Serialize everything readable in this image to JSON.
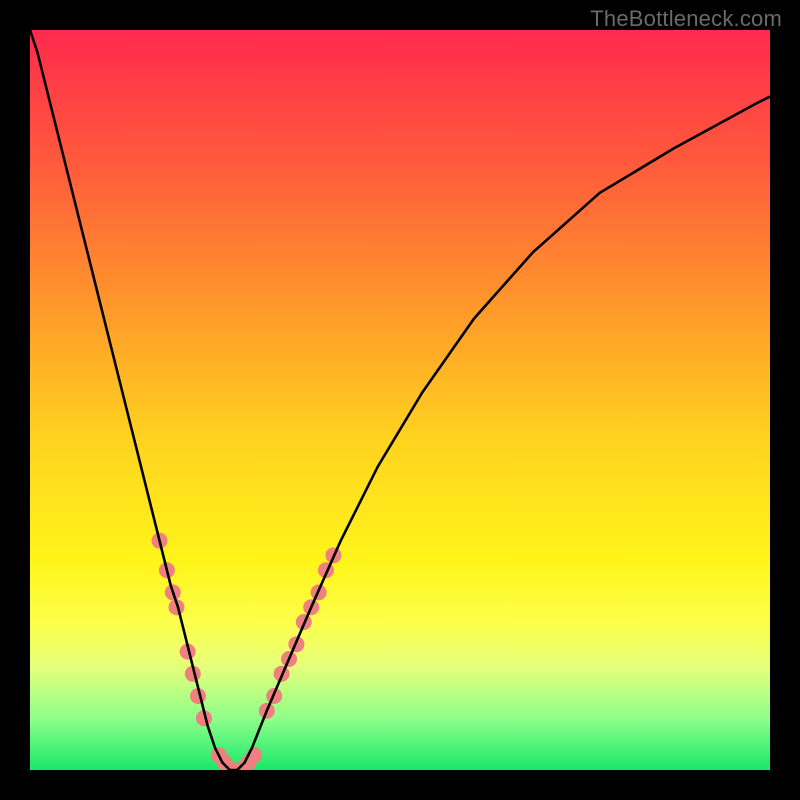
{
  "watermark": "TheBottleneck.com",
  "chart_data": {
    "type": "line",
    "title": "",
    "xlabel": "",
    "ylabel": "",
    "xlim": [
      0,
      100
    ],
    "ylim": [
      0,
      100
    ],
    "legend": false,
    "grid": false,
    "background_gradient_stops": [
      {
        "offset": 0,
        "color": "#ff2a4d"
      },
      {
        "offset": 0.18,
        "color": "#ff5a3c"
      },
      {
        "offset": 0.38,
        "color": "#ff9a2a"
      },
      {
        "offset": 0.55,
        "color": "#ffd21f"
      },
      {
        "offset": 0.72,
        "color": "#fff51a"
      },
      {
        "offset": 0.8,
        "color": "#fcff4a"
      },
      {
        "offset": 0.86,
        "color": "#e6ff7a"
      },
      {
        "offset": 0.93,
        "color": "#8fff8a"
      },
      {
        "offset": 1.0,
        "color": "#19e86a"
      }
    ],
    "series": [
      {
        "name": "curve",
        "color": "#000000",
        "x": [
          0,
          1,
          2,
          3,
          5,
          7,
          9,
          11,
          13,
          15,
          17,
          19,
          20,
          21,
          22,
          23,
          24,
          25,
          26,
          27,
          28,
          29,
          30,
          32,
          35,
          38,
          42,
          47,
          53,
          60,
          68,
          77,
          87,
          98,
          100
        ],
        "y": [
          100,
          97,
          93,
          89,
          81,
          73,
          65,
          57,
          49,
          41,
          33,
          25,
          22,
          18,
          14,
          10,
          6,
          3,
          1,
          0,
          0,
          1,
          3,
          8,
          15,
          22,
          31,
          41,
          51,
          61,
          70,
          78,
          84,
          90,
          91
        ]
      }
    ],
    "marker_series": [
      {
        "name": "left-outer-cluster",
        "color": "#f08080",
        "points": [
          {
            "x": 17.5,
            "y": 31
          },
          {
            "x": 18.5,
            "y": 27
          },
          {
            "x": 19.3,
            "y": 24
          },
          {
            "x": 19.8,
            "y": 22
          }
        ]
      },
      {
        "name": "left-inner-cluster",
        "color": "#f08080",
        "points": [
          {
            "x": 21.3,
            "y": 16
          },
          {
            "x": 22.0,
            "y": 13
          },
          {
            "x": 22.7,
            "y": 10
          },
          {
            "x": 23.5,
            "y": 7
          }
        ]
      },
      {
        "name": "valley-floor",
        "color": "#f08080",
        "points": [
          {
            "x": 25.5,
            "y": 2
          },
          {
            "x": 26.3,
            "y": 1
          },
          {
            "x": 27.4,
            "y": 0
          },
          {
            "x": 28.5,
            "y": 0
          },
          {
            "x": 29.5,
            "y": 1
          },
          {
            "x": 30.3,
            "y": 2
          }
        ]
      },
      {
        "name": "right-inner-cluster",
        "color": "#f08080",
        "points": [
          {
            "x": 32.0,
            "y": 8
          },
          {
            "x": 33.0,
            "y": 10
          },
          {
            "x": 34.0,
            "y": 13
          },
          {
            "x": 35.0,
            "y": 15
          },
          {
            "x": 36.0,
            "y": 17
          }
        ]
      },
      {
        "name": "right-outer-cluster",
        "color": "#f08080",
        "points": [
          {
            "x": 37.0,
            "y": 20
          },
          {
            "x": 38.0,
            "y": 22
          },
          {
            "x": 39.0,
            "y": 24
          },
          {
            "x": 40.0,
            "y": 27
          },
          {
            "x": 41.0,
            "y": 29
          }
        ]
      }
    ]
  }
}
